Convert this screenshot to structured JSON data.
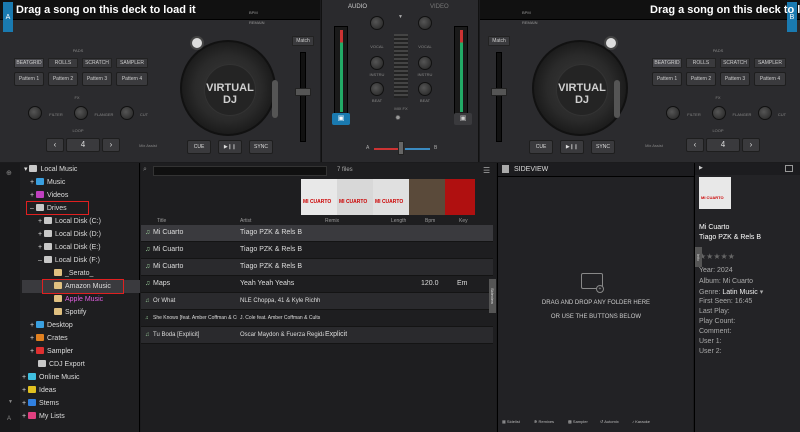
{
  "left_deck": {
    "letter": "A",
    "title": "Drag a song on this deck to load it",
    "bpm_label": "BPM",
    "remain_label": "REMAIN",
    "match_label": "Match",
    "pads_label": "PADS",
    "pad_modes": [
      "BEATGRID",
      "ROLLS",
      "SCRATCH",
      "SAMPLER"
    ],
    "patterns": [
      "Pattern 1",
      "Pattern 2",
      "Pattern 3",
      "Pattern 4"
    ],
    "fx_label": "FX",
    "fx": [
      "FILTER",
      "FLANGER",
      "CUT"
    ],
    "loop_label": "LOOP",
    "loop_value": "4",
    "mix_assist": "Mix Assist",
    "cue": "CUE",
    "play": "▶❙❙",
    "sync": "SYNC",
    "logo": "VIRTUAL DJ"
  },
  "right_deck": {
    "letter": "B",
    "title": "Drag a song on this deck to load it",
    "bpm_label": "BPM",
    "remain_label": "REMAIN",
    "match_label": "Match",
    "pads_label": "PADS",
    "pad_modes": [
      "BEATGRID",
      "ROLLS",
      "SCRATCH",
      "SAMPLER"
    ],
    "patterns": [
      "Pattern 1",
      "Pattern 2",
      "Pattern 3",
      "Pattern 4"
    ],
    "fx_label": "FX",
    "fx": [
      "FILTER",
      "FLANGER",
      "CUT"
    ],
    "loop_label": "LOOP",
    "loop_value": "4",
    "mix_assist": "Mix Assist",
    "cue": "CUE",
    "play": "▶❙❙",
    "sync": "SYNC",
    "logo": "VIRTUAL DJ"
  },
  "mixer": {
    "tab_audio": "AUDIO",
    "tab_video": "VIDEO",
    "labels": [
      "VOCAL",
      "INSTRU",
      "BEAT"
    ],
    "mix_fx": "MIX FX",
    "crossfader_a": "A",
    "crossfader_b": "B"
  },
  "sidebar": {
    "items": [
      {
        "label": "Local Music",
        "color": "#c8c8c8"
      },
      {
        "label": "Music",
        "color": "#3aa0e0"
      },
      {
        "label": "Videos",
        "color": "#c040c0"
      },
      {
        "label": "Drives",
        "color": "#c8c8c8"
      },
      {
        "label": "Local Disk (C:)",
        "color": "#c8c8c8"
      },
      {
        "label": "Local Disk (D:)",
        "color": "#c8c8c8"
      },
      {
        "label": "Local Disk (E:)",
        "color": "#c8c8c8"
      },
      {
        "label": "Local Disk (F:)",
        "color": "#c8c8c8"
      },
      {
        "label": "_Serato_",
        "color": "#e0c080"
      },
      {
        "label": "Amazon Music",
        "color": "#e0c080"
      },
      {
        "label": "Apple Music",
        "color": "#e0c080"
      },
      {
        "label": "Spotify",
        "color": "#e0c080"
      },
      {
        "label": "Desktop",
        "color": "#3aa0e0"
      },
      {
        "label": "Crates",
        "color": "#e08020"
      },
      {
        "label": "Sampler",
        "color": "#e03030"
      },
      {
        "label": "CDJ Export",
        "color": "#c8c8c8"
      },
      {
        "label": "Online Music",
        "color": "#40c0e0"
      },
      {
        "label": "Ideas",
        "color": "#e0c020"
      },
      {
        "label": "Stems",
        "color": "#3080e0"
      },
      {
        "label": "My Lists",
        "color": "#e04080"
      }
    ]
  },
  "browser": {
    "search_placeholder": "",
    "file_count": "7 files",
    "columns": [
      "Title",
      "Artist",
      "Remix",
      "Length",
      "Bpm",
      "Key"
    ],
    "album_art_text": "MI CUARTO",
    "rows": [
      {
        "title": "Mi Cuarto",
        "artist": "Tiago PZK & Rels B",
        "remix": "",
        "length": "",
        "bpm": "",
        "key": ""
      },
      {
        "title": "Mi Cuarto",
        "artist": "Tiago PZK & Rels B",
        "remix": "",
        "length": "",
        "bpm": "",
        "key": ""
      },
      {
        "title": "Mi Cuarto",
        "artist": "Tiago PZK & Rels B",
        "remix": "",
        "length": "",
        "bpm": "",
        "key": ""
      },
      {
        "title": "Maps",
        "artist": "Yeah Yeah Yeahs",
        "remix": "",
        "length": "",
        "bpm": "120.0",
        "key": "Em"
      },
      {
        "title": "Or What",
        "artist": "NLE Choppa, 41 & Kyle Richh",
        "remix": "",
        "length": "",
        "bpm": "",
        "key": ""
      },
      {
        "title": "She Knows [feat. Amber Coffman & Cults]",
        "artist": "J. Cole feat. Amber Coffman & Cults",
        "remix": "",
        "length": "",
        "bpm": "",
        "key": ""
      },
      {
        "title": "Tu Boda [Explicit]",
        "artist": "Oscar Maydon & Fuerza Regida",
        "remix": "Explicit",
        "length": "",
        "bpm": "",
        "key": ""
      }
    ],
    "side_tab": "Sideview"
  },
  "sideview": {
    "title": "SIDEVIEW",
    "drop_line1": "DRAG AND DROP ANY FOLDER HERE",
    "drop_line2": "OR USE THE BUTTONS BELOW"
  },
  "info": {
    "title": "Mi Cuarto",
    "artist": "Tiago PZK & Rels B",
    "year": "Year: 2024",
    "album": "Album: Mi Cuarto",
    "genre_label": "Genre:",
    "genre_value": "Latin Music",
    "first_seen": "First Seen: 16:45",
    "last_play": "Last Play:",
    "play_count": "Play Count:",
    "comment": "Comment:",
    "user1": "User 1:",
    "user2": "User 2:",
    "tab": "Info"
  },
  "bottom_tabs": [
    "Sidelist",
    "Remixes",
    "Sampler",
    "Automix",
    "Karaoke"
  ],
  "colors": {
    "accent_blue": "#1a7ab0",
    "highlight_red": "#e02020"
  }
}
